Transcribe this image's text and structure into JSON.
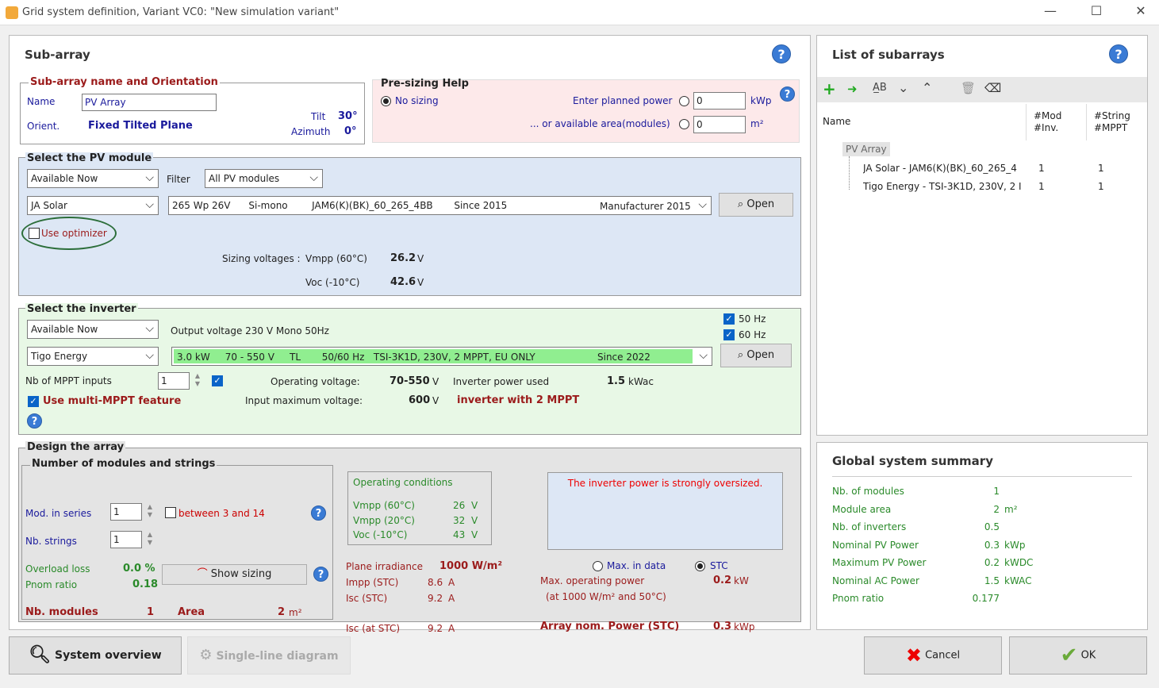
{
  "window": {
    "title": "Grid system definition, Variant VC0:  \"New simulation variant\"",
    "minimize": "—",
    "maximize": "☐",
    "close": "✕"
  },
  "subarray": {
    "title": "Sub-array",
    "name_orient": {
      "legend": "Sub-array name and Orientation",
      "name_label": "Name",
      "name_value": "PV Array",
      "orient_label": "Orient.",
      "orient_value": "Fixed Tilted Plane",
      "tilt_label": "Tilt",
      "tilt_value": "30°",
      "azimuth_label": "Azimuth",
      "azimuth_value": "0°"
    },
    "presizing": {
      "legend": "Pre-sizing Help",
      "no_sizing": "No sizing",
      "planned_power_label": "Enter planned power",
      "planned_power_value": "0",
      "planned_power_unit": "kWp",
      "area_label": "... or available area(modules)",
      "area_value": "0",
      "area_unit": "m²"
    },
    "pv_module": {
      "legend": "Select the PV module",
      "availability": "Available Now",
      "filter_label": "Filter",
      "filter_value": "All PV modules",
      "manufacturer": "JA Solar",
      "module_desc": "265 Wp 26V      Si-mono        JAM6(K)(BK)_60_265_4BB       Since 2015",
      "module_mfr": "Manufacturer 2015",
      "open": "Open",
      "use_optimizer": "Use optimizer",
      "sizing_voltages_label": "Sizing voltages :",
      "vmpp_label": "Vmpp (60°C)",
      "vmpp_value": "26.2",
      "voc_label": "Voc (-10°C)",
      "voc_value": "42.6",
      "unit_v": "V"
    },
    "inverter": {
      "legend": "Select the inverter",
      "availability": "Available Now",
      "output_voltage": "Output voltage 230 V Mono 50Hz",
      "hz50": "50 Hz",
      "hz60": "60 Hz",
      "manufacturer": "Tigo Energy",
      "inv_desc": "3.0 kW     70 - 550 V     TL       50/60 Hz   TSI-3K1D, 230V, 2 MPPT, EU ONLY",
      "inv_since": "Since 2022",
      "open": "Open",
      "nb_mppt_label": "Nb of MPPT inputs",
      "nb_mppt_value": "1",
      "operating_voltage_label": "Operating voltage:",
      "operating_voltage_value": "70-550",
      "inv_power_label": "Inverter power used",
      "inv_power_value": "1.5",
      "inv_power_unit": "kWac",
      "input_max_label": "Input maximum voltage:",
      "input_max_value": "600",
      "unit_v": "V",
      "multi_mppt_label": "Use multi-MPPT feature",
      "mppt_note": "inverter with 2 MPPT"
    },
    "design": {
      "legend": "Design the array",
      "sub_legend": "Number of modules and strings",
      "mod_series_label": "Mod. in series",
      "mod_series_value": "1",
      "between": "between 3 and 14",
      "nb_strings_label": "Nb. strings",
      "nb_strings_value": "1",
      "overload_label": "Overload loss",
      "overload_value": "0.0 %",
      "pnom_label": "Pnom ratio",
      "pnom_value": "0.18",
      "show_sizing": "Show sizing",
      "nb_modules_label": "Nb. modules",
      "nb_modules_value": "1",
      "area_label": "Area",
      "area_value": "2",
      "area_unit": "m²",
      "opcond": {
        "title": "Operating conditions",
        "rows": [
          {
            "label": "Vmpp (60°C)",
            "value": "26",
            "unit": "V"
          },
          {
            "label": "Vmpp (20°C)",
            "value": "32",
            "unit": "V"
          },
          {
            "label": "Voc (-10°C)",
            "value": "43",
            "unit": "V"
          }
        ]
      },
      "warning": "The inverter power is strongly oversized.",
      "plane_irr_label": "Plane irradiance",
      "plane_irr_value": "1000 W/m²",
      "max_in_data": "Max. in data",
      "stc": "STC",
      "impp_label": "Impp (STC)",
      "impp_value": "8.6",
      "isc_label": "Isc (STC)",
      "isc_value": "9.2",
      "isc_at_label": "Isc (at STC)",
      "isc_at_value": "9.2",
      "unit_a": "A",
      "max_op_label": "Max. operating power",
      "max_op_value": "0.2",
      "max_op_unit": "kW",
      "max_op_cond": "(at 1000 W/m²  and 50°C)",
      "array_nom_label": "Array nom. Power (STC)",
      "array_nom_value": "0.3",
      "array_nom_unit": "kWp"
    }
  },
  "subarrays_list": {
    "title": "List of subarrays",
    "col_name": "Name",
    "col_mod": "#Mod",
    "col_inv": "#Inv.",
    "col_string": "#String",
    "col_mppt": "#MPPT",
    "root": "PV Array",
    "rows": [
      {
        "name": "JA Solar - JAM6(K)(BK)_60_265_4",
        "mod": "1",
        "string": "1"
      },
      {
        "name": "Tigo Energy - TSI-3K1D, 230V, 2 I",
        "mod": "1",
        "string": "1"
      }
    ]
  },
  "summary": {
    "title": "Global system summary",
    "rows": [
      {
        "label": "Nb. of modules",
        "value": "1",
        "unit": ""
      },
      {
        "label": "Module area",
        "value": "2",
        "unit": "m²"
      },
      {
        "label": "Nb. of inverters",
        "value": "0.5",
        "unit": ""
      },
      {
        "label": "Nominal PV Power",
        "value": "0.3",
        "unit": "kWp"
      },
      {
        "label": "Maximum PV Power",
        "value": "0.2",
        "unit": "kWDC"
      },
      {
        "label": "Nominal AC Power",
        "value": "1.5",
        "unit": "kWAC"
      },
      {
        "label": "Pnom ratio",
        "value": "0.177",
        "unit": ""
      }
    ]
  },
  "footer": {
    "system_overview": "System overview",
    "single_line": "Single-line diagram",
    "cancel": "Cancel",
    "ok": "OK"
  }
}
